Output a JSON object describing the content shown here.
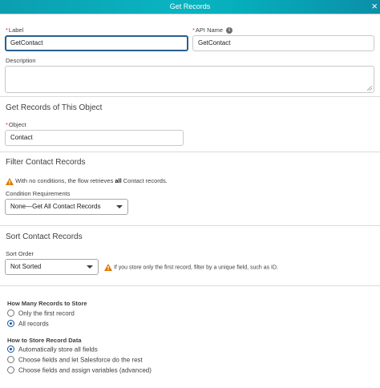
{
  "header": {
    "title": "Get Records",
    "close_icon": "×"
  },
  "fields": {
    "label": {
      "required_mark": "*",
      "label": "Label",
      "value": "GetContact"
    },
    "api_name": {
      "required_mark": "*",
      "label": "API Name",
      "value": "GetContact",
      "info_icon": "i"
    },
    "description": {
      "label": "Description",
      "value": ""
    }
  },
  "get_records_section": {
    "title": "Get Records of This Object",
    "object": {
      "required_mark": "*",
      "label": "Object",
      "value": "Contact"
    }
  },
  "filter_section": {
    "title": "Filter Contact Records",
    "warning_prefix": "With no conditions, the flow retrieves ",
    "warning_bold": "all",
    "warning_suffix": " Contact records.",
    "condition_label": "Condition Requirements",
    "condition_value": "None—Get All Contact Records"
  },
  "sort_section": {
    "title": "Sort Contact Records",
    "sort_label": "Sort Order",
    "sort_value": "Not Sorted",
    "hint": "If you store only the first record, filter by a unique field, such as ID."
  },
  "how_many": {
    "label": "How Many Records to Store",
    "options": [
      {
        "label": "Only the first record",
        "checked": false
      },
      {
        "label": "All records",
        "checked": true
      }
    ]
  },
  "how_to_store": {
    "label": "How to Store Record Data",
    "options": [
      {
        "label": "Automatically store all fields",
        "checked": true
      },
      {
        "label": "Choose fields and let Salesforce do the rest",
        "checked": false
      },
      {
        "label": "Choose fields and assign variables (advanced)",
        "checked": false
      }
    ]
  },
  "colors": {
    "header": "#0ab3c0",
    "focus_border": "#2b5e8c",
    "warning": "#dd7a01",
    "required": "#c23934",
    "radio": "#1b5297"
  }
}
